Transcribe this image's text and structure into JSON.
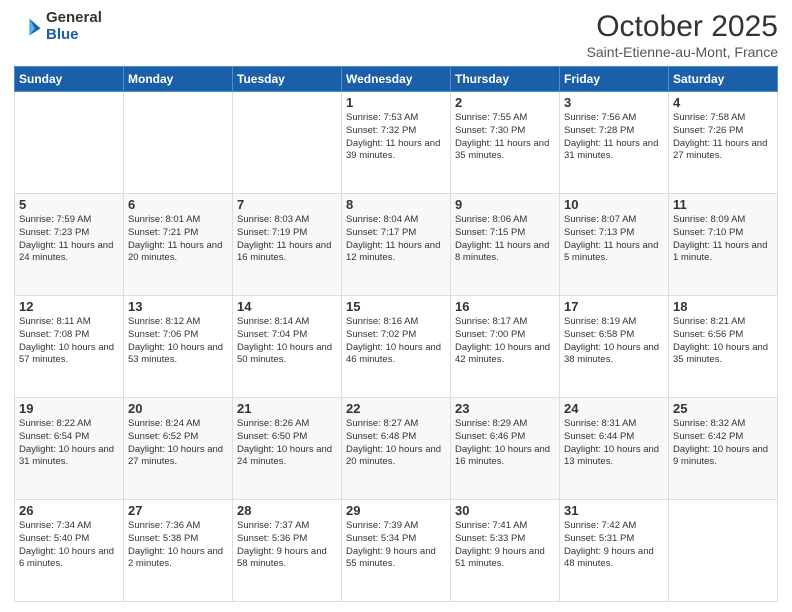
{
  "logo": {
    "general": "General",
    "blue": "Blue"
  },
  "header": {
    "title": "October 2025",
    "subtitle": "Saint-Etienne-au-Mont, France"
  },
  "days_of_week": [
    "Sunday",
    "Monday",
    "Tuesday",
    "Wednesday",
    "Thursday",
    "Friday",
    "Saturday"
  ],
  "weeks": [
    [
      {
        "num": "",
        "info": ""
      },
      {
        "num": "",
        "info": ""
      },
      {
        "num": "",
        "info": ""
      },
      {
        "num": "1",
        "info": "Sunrise: 7:53 AM\nSunset: 7:32 PM\nDaylight: 11 hours\nand 39 minutes."
      },
      {
        "num": "2",
        "info": "Sunrise: 7:55 AM\nSunset: 7:30 PM\nDaylight: 11 hours\nand 35 minutes."
      },
      {
        "num": "3",
        "info": "Sunrise: 7:56 AM\nSunset: 7:28 PM\nDaylight: 11 hours\nand 31 minutes."
      },
      {
        "num": "4",
        "info": "Sunrise: 7:58 AM\nSunset: 7:26 PM\nDaylight: 11 hours\nand 27 minutes."
      }
    ],
    [
      {
        "num": "5",
        "info": "Sunrise: 7:59 AM\nSunset: 7:23 PM\nDaylight: 11 hours\nand 24 minutes."
      },
      {
        "num": "6",
        "info": "Sunrise: 8:01 AM\nSunset: 7:21 PM\nDaylight: 11 hours\nand 20 minutes."
      },
      {
        "num": "7",
        "info": "Sunrise: 8:03 AM\nSunset: 7:19 PM\nDaylight: 11 hours\nand 16 minutes."
      },
      {
        "num": "8",
        "info": "Sunrise: 8:04 AM\nSunset: 7:17 PM\nDaylight: 11 hours\nand 12 minutes."
      },
      {
        "num": "9",
        "info": "Sunrise: 8:06 AM\nSunset: 7:15 PM\nDaylight: 11 hours\nand 8 minutes."
      },
      {
        "num": "10",
        "info": "Sunrise: 8:07 AM\nSunset: 7:13 PM\nDaylight: 11 hours\nand 5 minutes."
      },
      {
        "num": "11",
        "info": "Sunrise: 8:09 AM\nSunset: 7:10 PM\nDaylight: 11 hours\nand 1 minute."
      }
    ],
    [
      {
        "num": "12",
        "info": "Sunrise: 8:11 AM\nSunset: 7:08 PM\nDaylight: 10 hours\nand 57 minutes."
      },
      {
        "num": "13",
        "info": "Sunrise: 8:12 AM\nSunset: 7:06 PM\nDaylight: 10 hours\nand 53 minutes."
      },
      {
        "num": "14",
        "info": "Sunrise: 8:14 AM\nSunset: 7:04 PM\nDaylight: 10 hours\nand 50 minutes."
      },
      {
        "num": "15",
        "info": "Sunrise: 8:16 AM\nSunset: 7:02 PM\nDaylight: 10 hours\nand 46 minutes."
      },
      {
        "num": "16",
        "info": "Sunrise: 8:17 AM\nSunset: 7:00 PM\nDaylight: 10 hours\nand 42 minutes."
      },
      {
        "num": "17",
        "info": "Sunrise: 8:19 AM\nSunset: 6:58 PM\nDaylight: 10 hours\nand 38 minutes."
      },
      {
        "num": "18",
        "info": "Sunrise: 8:21 AM\nSunset: 6:56 PM\nDaylight: 10 hours\nand 35 minutes."
      }
    ],
    [
      {
        "num": "19",
        "info": "Sunrise: 8:22 AM\nSunset: 6:54 PM\nDaylight: 10 hours\nand 31 minutes."
      },
      {
        "num": "20",
        "info": "Sunrise: 8:24 AM\nSunset: 6:52 PM\nDaylight: 10 hours\nand 27 minutes."
      },
      {
        "num": "21",
        "info": "Sunrise: 8:26 AM\nSunset: 6:50 PM\nDaylight: 10 hours\nand 24 minutes."
      },
      {
        "num": "22",
        "info": "Sunrise: 8:27 AM\nSunset: 6:48 PM\nDaylight: 10 hours\nand 20 minutes."
      },
      {
        "num": "23",
        "info": "Sunrise: 8:29 AM\nSunset: 6:46 PM\nDaylight: 10 hours\nand 16 minutes."
      },
      {
        "num": "24",
        "info": "Sunrise: 8:31 AM\nSunset: 6:44 PM\nDaylight: 10 hours\nand 13 minutes."
      },
      {
        "num": "25",
        "info": "Sunrise: 8:32 AM\nSunset: 6:42 PM\nDaylight: 10 hours\nand 9 minutes."
      }
    ],
    [
      {
        "num": "26",
        "info": "Sunrise: 7:34 AM\nSunset: 5:40 PM\nDaylight: 10 hours\nand 6 minutes."
      },
      {
        "num": "27",
        "info": "Sunrise: 7:36 AM\nSunset: 5:38 PM\nDaylight: 10 hours\nand 2 minutes."
      },
      {
        "num": "28",
        "info": "Sunrise: 7:37 AM\nSunset: 5:36 PM\nDaylight: 9 hours\nand 58 minutes."
      },
      {
        "num": "29",
        "info": "Sunrise: 7:39 AM\nSunset: 5:34 PM\nDaylight: 9 hours\nand 55 minutes."
      },
      {
        "num": "30",
        "info": "Sunrise: 7:41 AM\nSunset: 5:33 PM\nDaylight: 9 hours\nand 51 minutes."
      },
      {
        "num": "31",
        "info": "Sunrise: 7:42 AM\nSunset: 5:31 PM\nDaylight: 9 hours\nand 48 minutes."
      },
      {
        "num": "",
        "info": ""
      }
    ]
  ]
}
